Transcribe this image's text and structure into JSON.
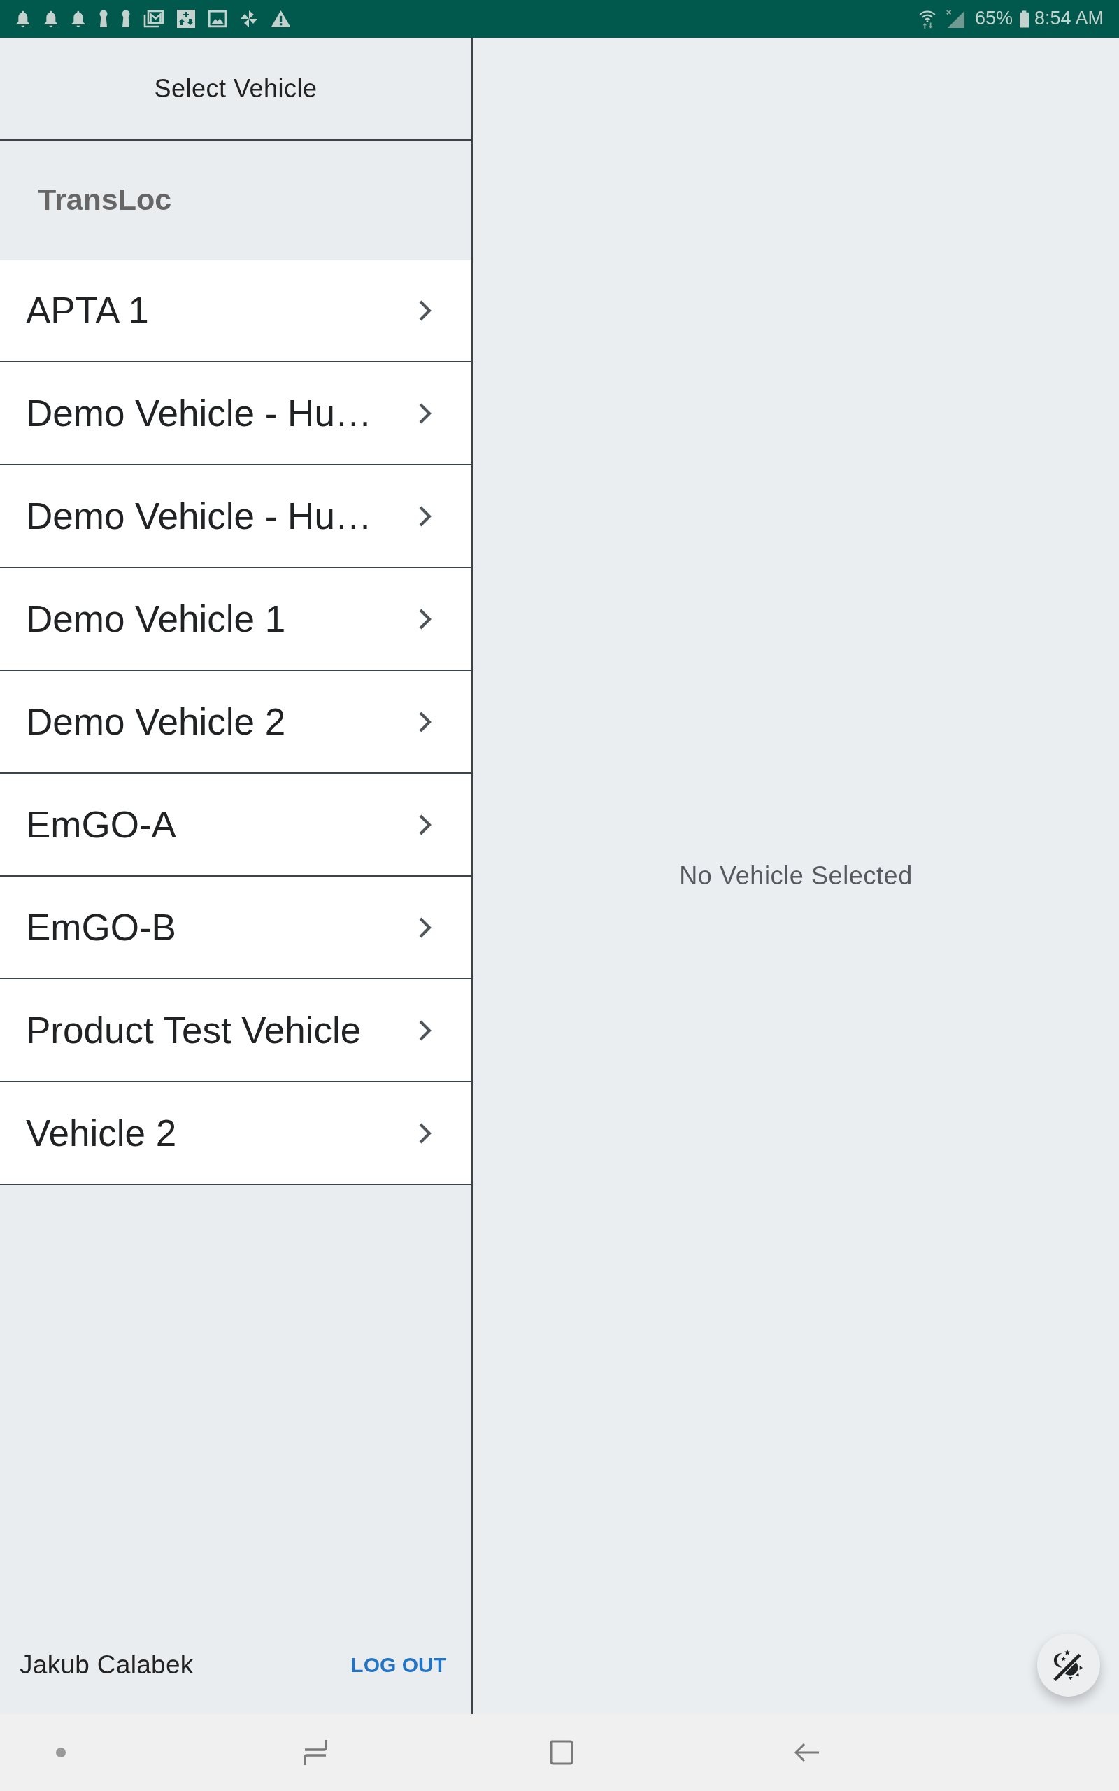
{
  "status_bar": {
    "battery": "65%",
    "time": "8:54 AM"
  },
  "vehicle_panel": {
    "title": "Select Vehicle",
    "group": "TransLoc",
    "vehicles": [
      {
        "label": "APTA 1",
        "selected": false
      },
      {
        "label": "Demo Vehicle - Hu…",
        "selected": false
      },
      {
        "label": "Demo Vehicle - Hu…",
        "selected": false
      },
      {
        "label": "Demo Vehicle 1",
        "selected": false
      },
      {
        "label": "Demo Vehicle 2",
        "selected": false
      },
      {
        "label": "EmGO-A",
        "selected": false
      },
      {
        "label": "EmGO-B",
        "selected": false
      },
      {
        "label": "Product Test Vehicle",
        "selected": false
      },
      {
        "label": "Vehicle 2",
        "selected": false
      }
    ],
    "user_name": "Jakub Calabek",
    "logout": "LOG OUT"
  },
  "detail_panel": {
    "empty_message": "No Vehicle Selected"
  }
}
